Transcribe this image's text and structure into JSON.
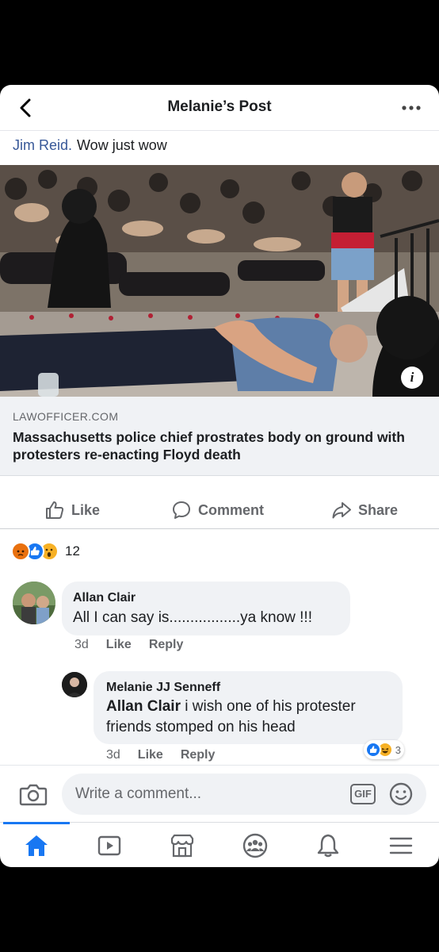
{
  "header": {
    "title": "Melanie’s Post"
  },
  "post": {
    "author": "Jim Reid.",
    "message": "Wow just wow"
  },
  "link_preview": {
    "domain": "LAWOFFICER.COM",
    "headline": "Massachusetts police chief prostrates body on ground with protesters re-enacting Floyd death",
    "info_label": "i"
  },
  "actions": {
    "like": "Like",
    "comment": "Comment",
    "share": "Share"
  },
  "reactions": {
    "count": "12",
    "types": [
      "angry",
      "like",
      "wow"
    ],
    "colors": {
      "angry": "#e9710f",
      "like": "#1877f2",
      "wow": "#f7b125"
    }
  },
  "comments": [
    {
      "name": "Allan Clair",
      "text": "All I can say is.................ya know !!!",
      "time": "3d",
      "like": "Like",
      "reply": "Reply"
    },
    {
      "name": "Melanie JJ Senneff",
      "mention": "Allan Clair",
      "text": " i wish one of his protester friends stomped on his head",
      "time": "3d",
      "like": "Like",
      "reply": "Reply",
      "reaction_count": "3"
    }
  ],
  "composer": {
    "placeholder": "Write a comment...",
    "gif": "GIF"
  },
  "nav": {
    "items": [
      "home-icon",
      "watch-icon",
      "marketplace-icon",
      "groups-icon",
      "notifications-icon",
      "menu-icon"
    ],
    "active_color": "#1877f2"
  }
}
